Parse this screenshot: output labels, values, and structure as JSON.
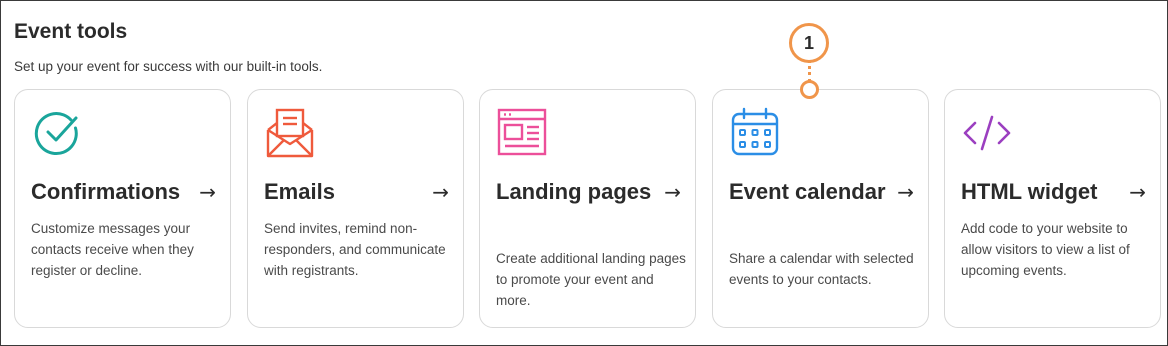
{
  "header": {
    "title": "Event tools",
    "subtitle": "Set up your event for success with our built-in tools."
  },
  "cards": [
    {
      "title": "Confirmations",
      "arrow": "→",
      "description": "Customize messages your contacts receive when they register or decline.",
      "icon": "check-circle-icon",
      "color": "#1aa59b"
    },
    {
      "title": "Emails",
      "arrow": "→",
      "description": "Send invites, remind non-responders, and communicate with registrants.",
      "icon": "envelope-icon",
      "color": "#ef5a3c"
    },
    {
      "title": "Landing pages",
      "arrow": "→",
      "description": "Create additional landing pages to promote your event and more.",
      "icon": "landing-page-icon",
      "color": "#ec4f9a"
    },
    {
      "title": "Event calendar",
      "arrow": "→",
      "description": "Share a calendar with selected events to your contacts.",
      "icon": "calendar-icon",
      "color": "#2b8ee6"
    },
    {
      "title": "HTML widget",
      "arrow": "→",
      "description": "Add code to your website to allow visitors to view a list of upcoming events.",
      "icon": "code-icon",
      "color": "#9b3fc0"
    }
  ],
  "callout": {
    "number": "1",
    "color": "#f0954a"
  }
}
